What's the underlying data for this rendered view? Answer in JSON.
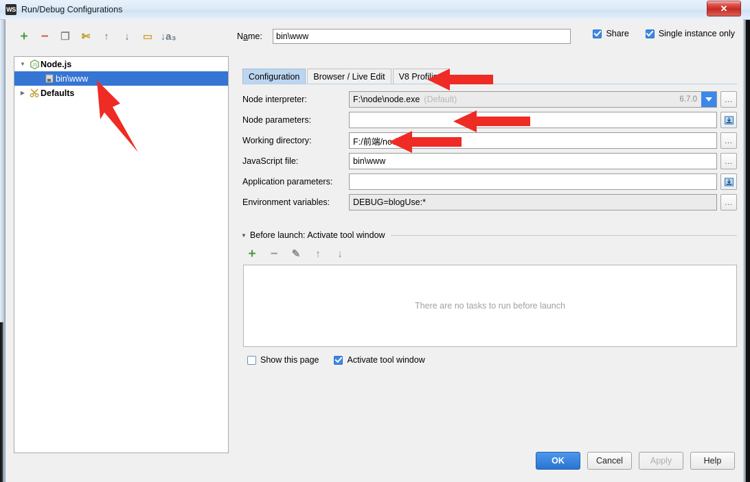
{
  "window": {
    "title": "Run/Debug Configurations",
    "app_icon_text": "WS",
    "close_label": "✕"
  },
  "left_toolbar": {
    "items": [
      {
        "name": "add-button",
        "glyph": "+",
        "color": "#4a9a4a"
      },
      {
        "name": "remove-button",
        "glyph": "−",
        "color": "#d05a52"
      },
      {
        "name": "copy-button",
        "glyph": "❐",
        "color": "#8a8a8a"
      },
      {
        "name": "edit-templates-button",
        "glyph": "✄",
        "color": "#c2a33a"
      },
      {
        "name": "move-up-button",
        "glyph": "↑",
        "color": "#7b7b6a"
      },
      {
        "name": "move-down-button",
        "glyph": "↓",
        "color": "#7b7b6a"
      },
      {
        "name": "folder-button",
        "glyph": "▭",
        "color": "#d4a63c"
      },
      {
        "name": "sort-alphabetically-button",
        "glyph": "↓a₃",
        "color": "#6b7a8a"
      }
    ]
  },
  "tree": {
    "nodes": [
      {
        "label": "Node.js",
        "level": 0,
        "expanded": true,
        "selected": false,
        "bold": true,
        "icon": "nodejs-icon"
      },
      {
        "label": "bin\\www",
        "level": 1,
        "expanded": null,
        "selected": true,
        "bold": false,
        "icon": "config-file-icon"
      },
      {
        "label": "Defaults",
        "level": 0,
        "expanded": false,
        "selected": false,
        "bold": true,
        "icon": "defaults-icon"
      }
    ]
  },
  "name_field": {
    "label": "Name:",
    "value": "bin\\www",
    "placeholder": ""
  },
  "top_options": [
    {
      "label": "Share",
      "checked": true,
      "name": "share-checkbox"
    },
    {
      "label": "Single instance only",
      "checked": true,
      "name": "single-instance-only-checkbox"
    }
  ],
  "tabs": [
    {
      "label": "Configuration",
      "active": true
    },
    {
      "label": "Browser / Live Edit",
      "active": false
    },
    {
      "label": "V8 Profiling",
      "active": false
    }
  ],
  "form": {
    "rows": [
      {
        "name": "node-interpreter",
        "label": "Node interpreter:",
        "value": "F:\\node\\node.exe",
        "hint": "(Default)",
        "version": "6.7.0",
        "readonly": true,
        "control": "combo",
        "button": "browse"
      },
      {
        "name": "node-parameters",
        "label": "Node parameters:",
        "value": "",
        "readonly": false,
        "control": "text",
        "button": "macro"
      },
      {
        "name": "working-directory",
        "label": "Working directory:",
        "value": "F:/前端/node/blogUse",
        "readonly": false,
        "control": "text",
        "button": "browse"
      },
      {
        "name": "javascript-file",
        "label": "JavaScript file:",
        "value": "bin\\www",
        "readonly": false,
        "control": "text",
        "button": "browse"
      },
      {
        "name": "application-parameters",
        "label": "Application parameters:",
        "value": "",
        "readonly": false,
        "control": "text",
        "button": "macro"
      },
      {
        "name": "environment-variables",
        "label": "Environment variables:",
        "value": "DEBUG=blogUse:*",
        "readonly": true,
        "control": "text",
        "button": "browse"
      }
    ],
    "browse_glyph": "…",
    "macro_glyph": "⬆"
  },
  "before_launch": {
    "title": "Before launch: Activate tool window",
    "triangle": "▼",
    "toolbar": [
      {
        "name": "bl-add-button",
        "glyph": "+",
        "color": "#4a9a4a"
      },
      {
        "name": "bl-remove-button",
        "glyph": "−",
        "color": "#9a9a9a"
      },
      {
        "name": "bl-edit-button",
        "glyph": "✎",
        "color": "#8a8a8a"
      },
      {
        "name": "bl-move-up-button",
        "glyph": "↑",
        "color": "#8a8a8a"
      },
      {
        "name": "bl-move-down-button",
        "glyph": "↓",
        "color": "#8a8a8a"
      }
    ],
    "empty_text": "There are no tasks to run before launch"
  },
  "bottom_options": [
    {
      "label": "Show this page",
      "checked": false,
      "name": "show-this-page-checkbox"
    },
    {
      "label": "Activate tool window",
      "checked": true,
      "name": "activate-tool-window-checkbox"
    }
  ],
  "dialog_buttons": [
    {
      "label": "OK",
      "style": "primary",
      "name": "ok-button"
    },
    {
      "label": "Cancel",
      "style": "normal",
      "name": "cancel-button"
    },
    {
      "label": "Apply",
      "style": "disabled",
      "name": "apply-button"
    },
    {
      "label": "Help",
      "style": "normal",
      "name": "help-button"
    }
  ],
  "colors": {
    "accent": "#3b88e8",
    "selection": "#3575d3",
    "annotation": "#ee2b24",
    "tab_active": "#bcd6f0"
  }
}
